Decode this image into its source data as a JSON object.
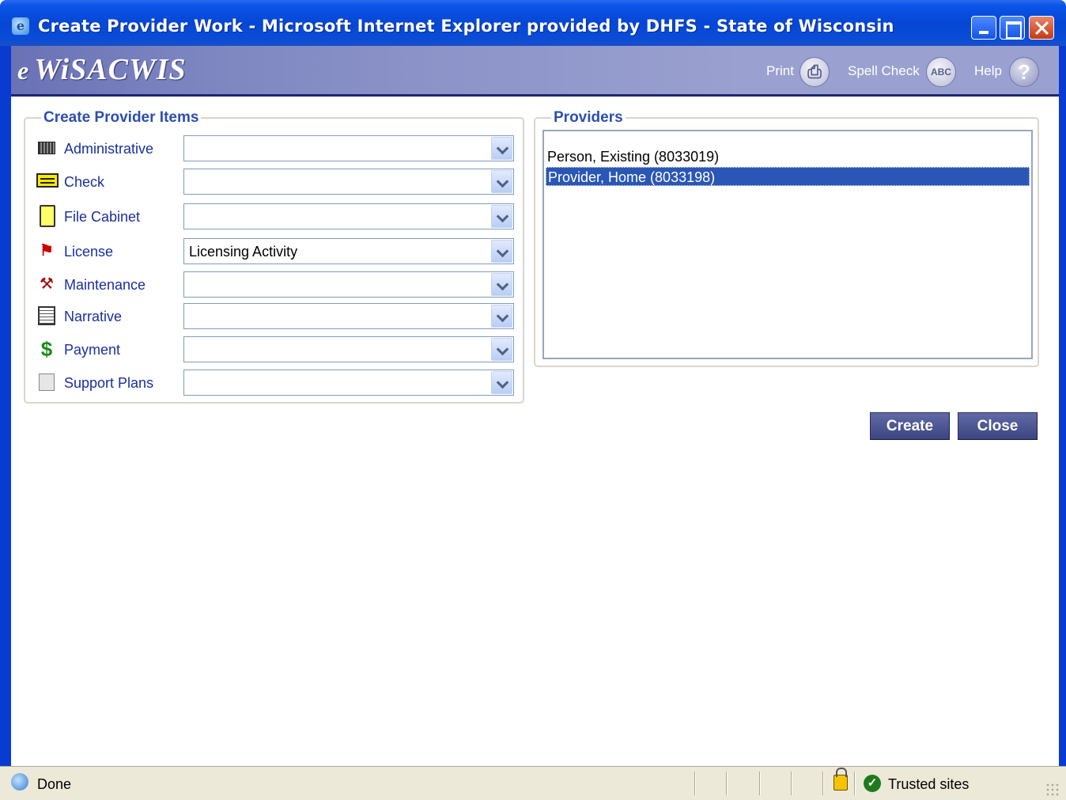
{
  "window": {
    "title": "Create Provider Work - Microsoft Internet Explorer provided by DHFS - State of Wisconsin",
    "icon": "ie-icon"
  },
  "banner": {
    "logo_prefix": "e",
    "logo": "WiSACWIS",
    "print_label": "Print",
    "spell_check_label": "Spell Check",
    "help_label": "Help",
    "spell_icon_text": "ABC",
    "help_icon_text": "?"
  },
  "create_items": {
    "legend": "Create Provider Items",
    "rows": [
      {
        "label": "Administrative",
        "value": "",
        "icon": "building-icon"
      },
      {
        "label": "Check",
        "value": "",
        "icon": "check-icon"
      },
      {
        "label": "File Cabinet",
        "value": "",
        "icon": "file-cabinet-icon"
      },
      {
        "label": "License",
        "value": "Licensing Activity",
        "icon": "license-icon"
      },
      {
        "label": "Maintenance",
        "value": "",
        "icon": "maintenance-icon"
      },
      {
        "label": "Narrative",
        "value": "",
        "icon": "narrative-icon"
      },
      {
        "label": "Payment",
        "value": "",
        "icon": "dollar-icon"
      },
      {
        "label": "Support Plans",
        "value": "",
        "icon": "support-plans-icon"
      }
    ]
  },
  "providers": {
    "legend": "Providers",
    "items": [
      {
        "label": "Person, Existing (8033019)",
        "selected": false
      },
      {
        "label": "Provider, Home (8033198)",
        "selected": true
      }
    ]
  },
  "buttons": {
    "create": "Create",
    "close": "Close"
  },
  "statusbar": {
    "status": "Done",
    "zone": "Trusted sites"
  },
  "colors": {
    "title_bar": "#0646d4",
    "banner": "#8b93c8",
    "legend_text": "#2d4eb0",
    "label_text": "#1a2fa0",
    "selection": "#2a56b6",
    "button": "#4a5290"
  }
}
